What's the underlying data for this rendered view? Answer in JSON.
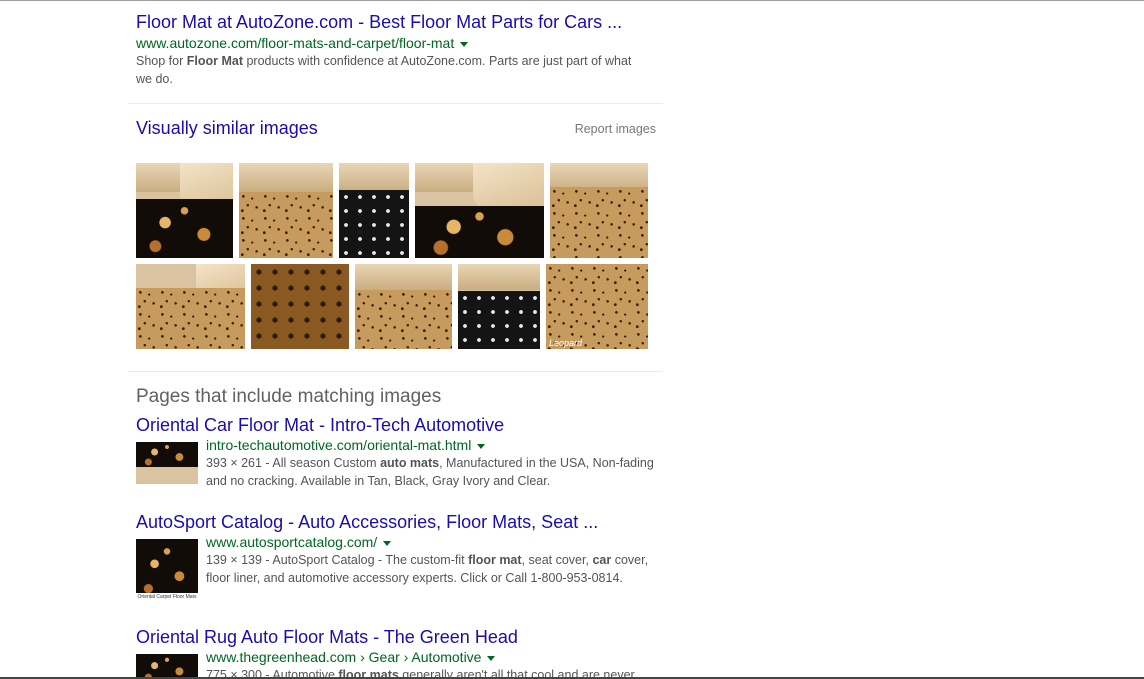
{
  "top_result": {
    "title": "Floor Mat at AutoZone.com - Best Floor Mat Parts for Cars ...",
    "url": "www.autozone.com/floor-mats-and-carpet/floor-mat",
    "snippet_1": "Shop for ",
    "snippet_bold_1": "Floor Mat",
    "snippet_2": " products with confidence at AutoZone.com. Parts are just part of what we do."
  },
  "visually_similar": {
    "title": "Visually similar images",
    "report_label": "Report images",
    "watermark": "Leopard"
  },
  "pages_section": {
    "title": "Pages that include matching images",
    "results": [
      {
        "title": "Oriental Car Floor Mat - Intro-Tech Automotive",
        "url": "intro-techautomotive.com/oriental-mat.html",
        "snippet_1": "393 × 261 - All season Custom ",
        "snippet_bold_1": "auto mats",
        "snippet_2": ", Manufactured in the USA, Non-fading and no cracking. Available in Tan, Black, Gray Ivory and Clear."
      },
      {
        "title": "AutoSport Catalog - Auto Accessories, Floor Mats, Seat ...",
        "url": "www.autosportcatalog.com/",
        "snippet_1": "139 × 139 - AutoSport Catalog - The custom-fit ",
        "snippet_bold_1": "floor mat",
        "snippet_2": ", seat cover, ",
        "snippet_bold_2": "car",
        "snippet_3": " cover, floor liner, and automotive accessory experts. Click or Call 1-800-953-0814.",
        "thumb_caption": "Oriental Carpet Floor Mats"
      },
      {
        "title": "Oriental Rug Auto Floor Mats - The Green Head",
        "url": "www.thegreenhead.com › Gear › Automotive",
        "snippet_1": "775 × 300 - Automotive ",
        "snippet_bold_1": "floor mats",
        "snippet_2": " generally aren't all that cool and are never"
      }
    ]
  }
}
